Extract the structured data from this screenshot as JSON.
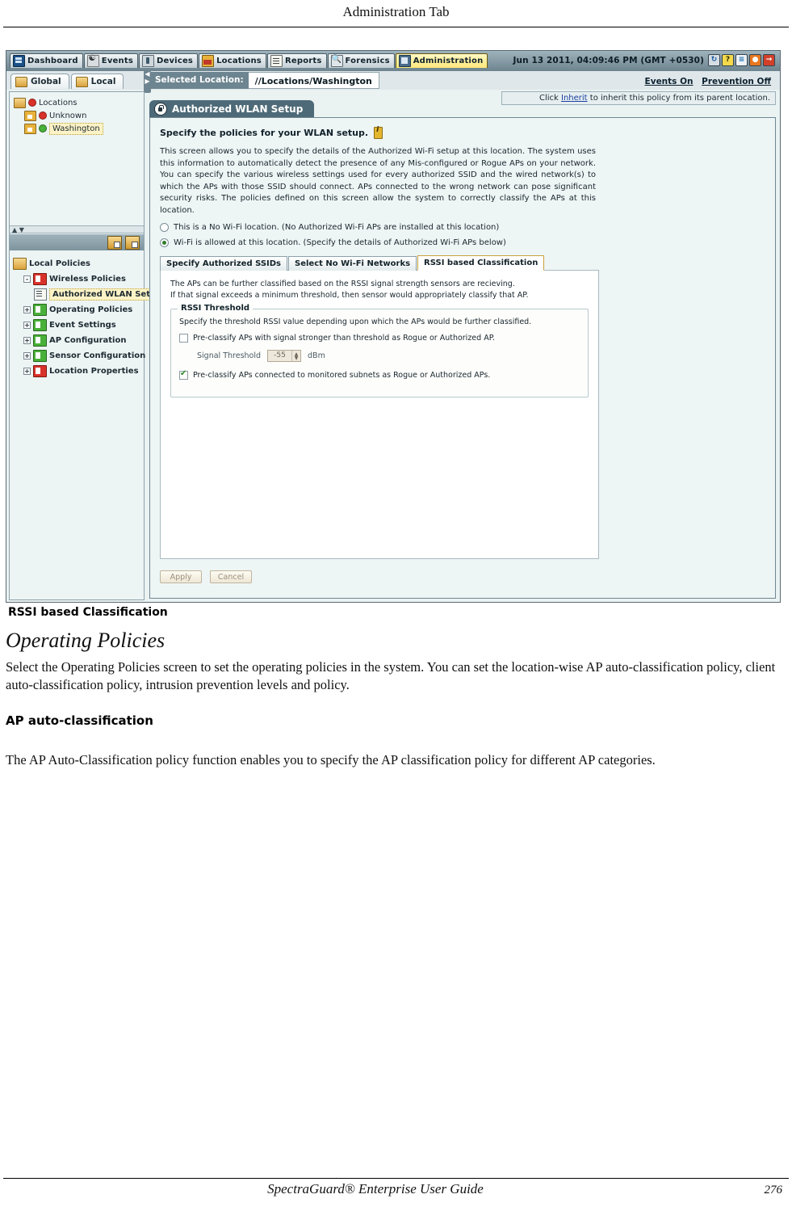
{
  "document": {
    "header_title": "Administration Tab",
    "caption": "RSSI based Classification",
    "heading_operating_policies": "Operating Policies",
    "paragraph_operating_policies": "Select the Operating Policies screen to set the operating policies in the system. You can set the location-wise AP auto-classification policy, client auto-classification policy, intrusion prevention levels and policy.",
    "subheading_ap_auto_classification": "AP auto-classification",
    "paragraph_ap_auto_classification": "The AP Auto-Classification policy function enables you to specify the AP classification policy for different AP categories.",
    "footer_title": "SpectraGuard® Enterprise User Guide",
    "footer_page": "276"
  },
  "app": {
    "nav_tabs": [
      {
        "label": "Dashboard",
        "icon": "dashboard-icon",
        "active": false
      },
      {
        "label": "Events",
        "icon": "events-icon",
        "active": false
      },
      {
        "label": "Devices",
        "icon": "devices-icon",
        "active": false
      },
      {
        "label": "Locations",
        "icon": "locations-icon",
        "active": false
      },
      {
        "label": "Reports",
        "icon": "reports-icon",
        "active": false
      },
      {
        "label": "Forensics",
        "icon": "forensics-icon",
        "active": false
      },
      {
        "label": "Administration",
        "icon": "administration-icon",
        "active": true
      }
    ],
    "datetime": "Jun 13 2011, 04:09:46 PM (GMT +0530)",
    "toolbar_icons": [
      {
        "name": "refresh-icon",
        "glyph": "↻"
      },
      {
        "name": "help-icon",
        "glyph": "?"
      },
      {
        "name": "list-icon",
        "glyph": "≡"
      },
      {
        "name": "stop-prevention-icon",
        "glyph": "●"
      },
      {
        "name": "logout-icon",
        "glyph": "→"
      }
    ],
    "status_bar": {
      "events": "Events On",
      "prevention": "Prevention Off"
    },
    "inherit_text_before": "Click ",
    "inherit_link": "Inherit",
    "inherit_text_after": " to inherit this policy from its parent location.",
    "scope_tabs": [
      {
        "label": "Global",
        "active": false
      },
      {
        "label": "Local",
        "active": true
      }
    ],
    "selected_location": {
      "label": "Selected Location:",
      "value": "//Locations/Washington"
    },
    "location_tree": [
      {
        "label": "Locations",
        "icon": "folder-icon",
        "status": "red",
        "indent": 0,
        "highlight": false
      },
      {
        "label": "Unknown",
        "icon": "house-icon",
        "status": "red",
        "indent": 1,
        "highlight": false
      },
      {
        "label": "Washington",
        "icon": "house-icon",
        "status": "green",
        "indent": 1,
        "highlight": true
      }
    ],
    "policy_tree_title": "Local Policies",
    "policy_tree": [
      {
        "label": "Wireless Policies",
        "icon": "red-policy-icon",
        "expander": "-",
        "indent": 1,
        "highlight": false
      },
      {
        "label": "Authorized WLAN Setup",
        "icon": "page-icon",
        "expander": "",
        "indent": 2,
        "highlight": true
      },
      {
        "label": "Operating Policies",
        "icon": "green-policy-icon",
        "expander": "+",
        "indent": 1,
        "highlight": false
      },
      {
        "label": "Event Settings",
        "icon": "green-policy-icon",
        "expander": "+",
        "indent": 1,
        "highlight": false
      },
      {
        "label": "AP Configuration",
        "icon": "green-policy-icon",
        "expander": "+",
        "indent": 1,
        "highlight": false
      },
      {
        "label": "Sensor Configuration",
        "icon": "green-policy-icon",
        "expander": "+",
        "indent": 1,
        "highlight": false
      },
      {
        "label": "Location Properties",
        "icon": "red-policy-icon",
        "expander": "+",
        "indent": 1,
        "highlight": false
      }
    ],
    "panel": {
      "title": "Authorized WLAN Setup",
      "heading": "Specify the policies for your WLAN setup.",
      "description": "This screen allows you to specify the details of the Authorized Wi-Fi setup at this location. The system uses this information to automatically detect the presence of any Mis-configured or Rogue APs on your network. You can specify the various wireless settings used for every authorized SSID and the wired network(s) to which the APs with those SSID should connect. APs connected to the wrong network can pose significant security risks. The policies defined on this screen allow the system to correctly classify the APs at this location.",
      "radio_no_wifi": "This is a No Wi-Fi location. (No Authorized Wi-Fi APs are installed at this location)",
      "radio_wifi_allowed": "Wi-Fi is allowed at this location. (Specify the details of Authorized Wi-Fi APs below)",
      "radio_selected": "wifi_allowed",
      "inner_tabs": [
        {
          "label": "Specify Authorized SSIDs",
          "active": false
        },
        {
          "label": "Select No Wi-Fi Networks",
          "active": false
        },
        {
          "label": "RSSI based Classification",
          "active": true
        }
      ],
      "rssi_tab": {
        "description_line1": "The APs can be further classified based on the RSSI signal strength sensors are recieving.",
        "description_line2": "If that signal exceeds a minimum threshold, then sensor would appropriately classify that AP.",
        "fieldset_legend": "RSSI Threshold",
        "fieldset_description": "Specify the threshold RSSI value depending upon which the APs would be further classified.",
        "checkbox_preclassify_signal": {
          "label": "Pre-classify APs with signal stronger than threshold as Rogue or Authorized AP.",
          "checked": false
        },
        "signal_threshold_label": "Signal Threshold",
        "signal_threshold_value": "-55",
        "signal_threshold_unit": "dBm",
        "checkbox_preclassify_subnets": {
          "label": "Pre-classify APs connected to monitored subnets as Rogue or Authorized APs.",
          "checked": true
        }
      },
      "buttons": {
        "apply": "Apply",
        "cancel": "Cancel"
      }
    }
  }
}
